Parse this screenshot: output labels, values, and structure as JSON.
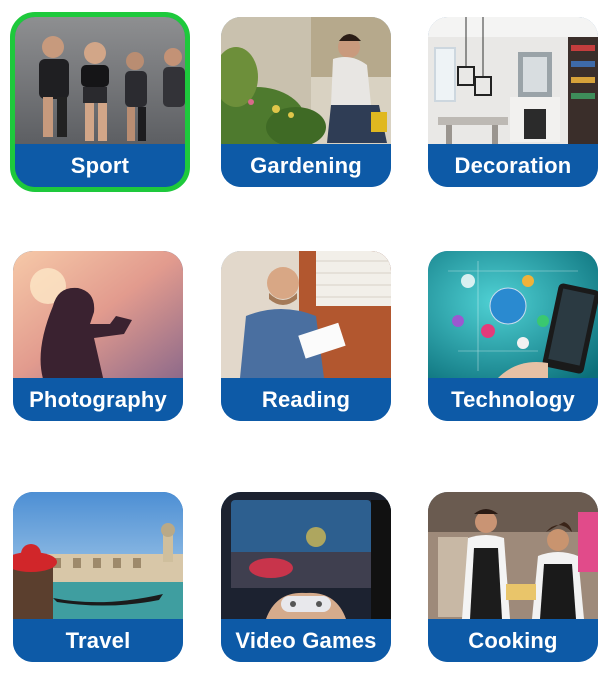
{
  "tiles": [
    {
      "id": "sport",
      "label": "Sport",
      "selected": true,
      "selection_color": "#1ec93c"
    },
    {
      "id": "gardening",
      "label": "Gardening",
      "selected": false
    },
    {
      "id": "decoration",
      "label": "Decoration",
      "selected": false
    },
    {
      "id": "photography",
      "label": "Photography",
      "selected": false
    },
    {
      "id": "reading",
      "label": "Reading",
      "selected": false
    },
    {
      "id": "technology",
      "label": "Technology",
      "selected": false
    },
    {
      "id": "travel",
      "label": "Travel",
      "selected": false
    },
    {
      "id": "video-games",
      "label": "Video Games",
      "selected": false
    },
    {
      "id": "cooking",
      "label": "Cooking",
      "selected": false
    }
  ],
  "colors": {
    "label_bg": "#0d5aa7",
    "label_text": "#ffffff",
    "selected_border": "#1ec93c"
  }
}
